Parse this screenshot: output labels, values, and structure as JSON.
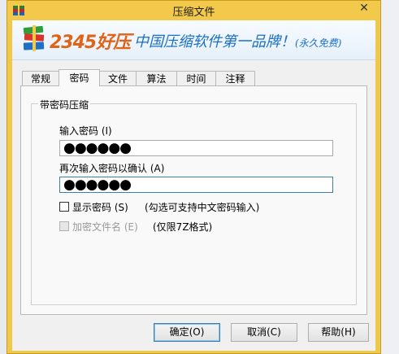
{
  "window": {
    "title": "压缩文件",
    "close_label": "✕"
  },
  "banner": {
    "brand": "2345好压",
    "slogan": "中国压缩软件第一品牌！",
    "slogan_sub": "(永久免费)"
  },
  "tabs": [
    {
      "label": "常规",
      "active": false
    },
    {
      "label": "密码",
      "active": true
    },
    {
      "label": "文件",
      "active": false
    },
    {
      "label": "算法",
      "active": false
    },
    {
      "label": "时间",
      "active": false
    },
    {
      "label": "注释",
      "active": false
    }
  ],
  "password_group": {
    "title": "带密码压缩",
    "enter_label": "输入密码 (I)",
    "enter_value": "●●●●●●",
    "confirm_label": "再次输入密码以确认 (A)",
    "confirm_value": "●●●●●●",
    "show_password_label": "显示密码 (S)",
    "show_password_checked": false,
    "show_password_hint": "(勾选可支持中文密码输入)",
    "encrypt_names_label": "加密文件名 (E)",
    "encrypt_names_checked": false,
    "encrypt_names_enabled": false,
    "encrypt_names_hint": "(仅限7Z格式)"
  },
  "buttons": {
    "ok": "确定(O)",
    "cancel": "取消(C)",
    "help": "帮助(H)"
  },
  "colors": {
    "title_bar": "#f2c94a",
    "slogan": "#1a6fc6",
    "brand": "#e0631a",
    "focus_border": "#3c7fb1"
  }
}
